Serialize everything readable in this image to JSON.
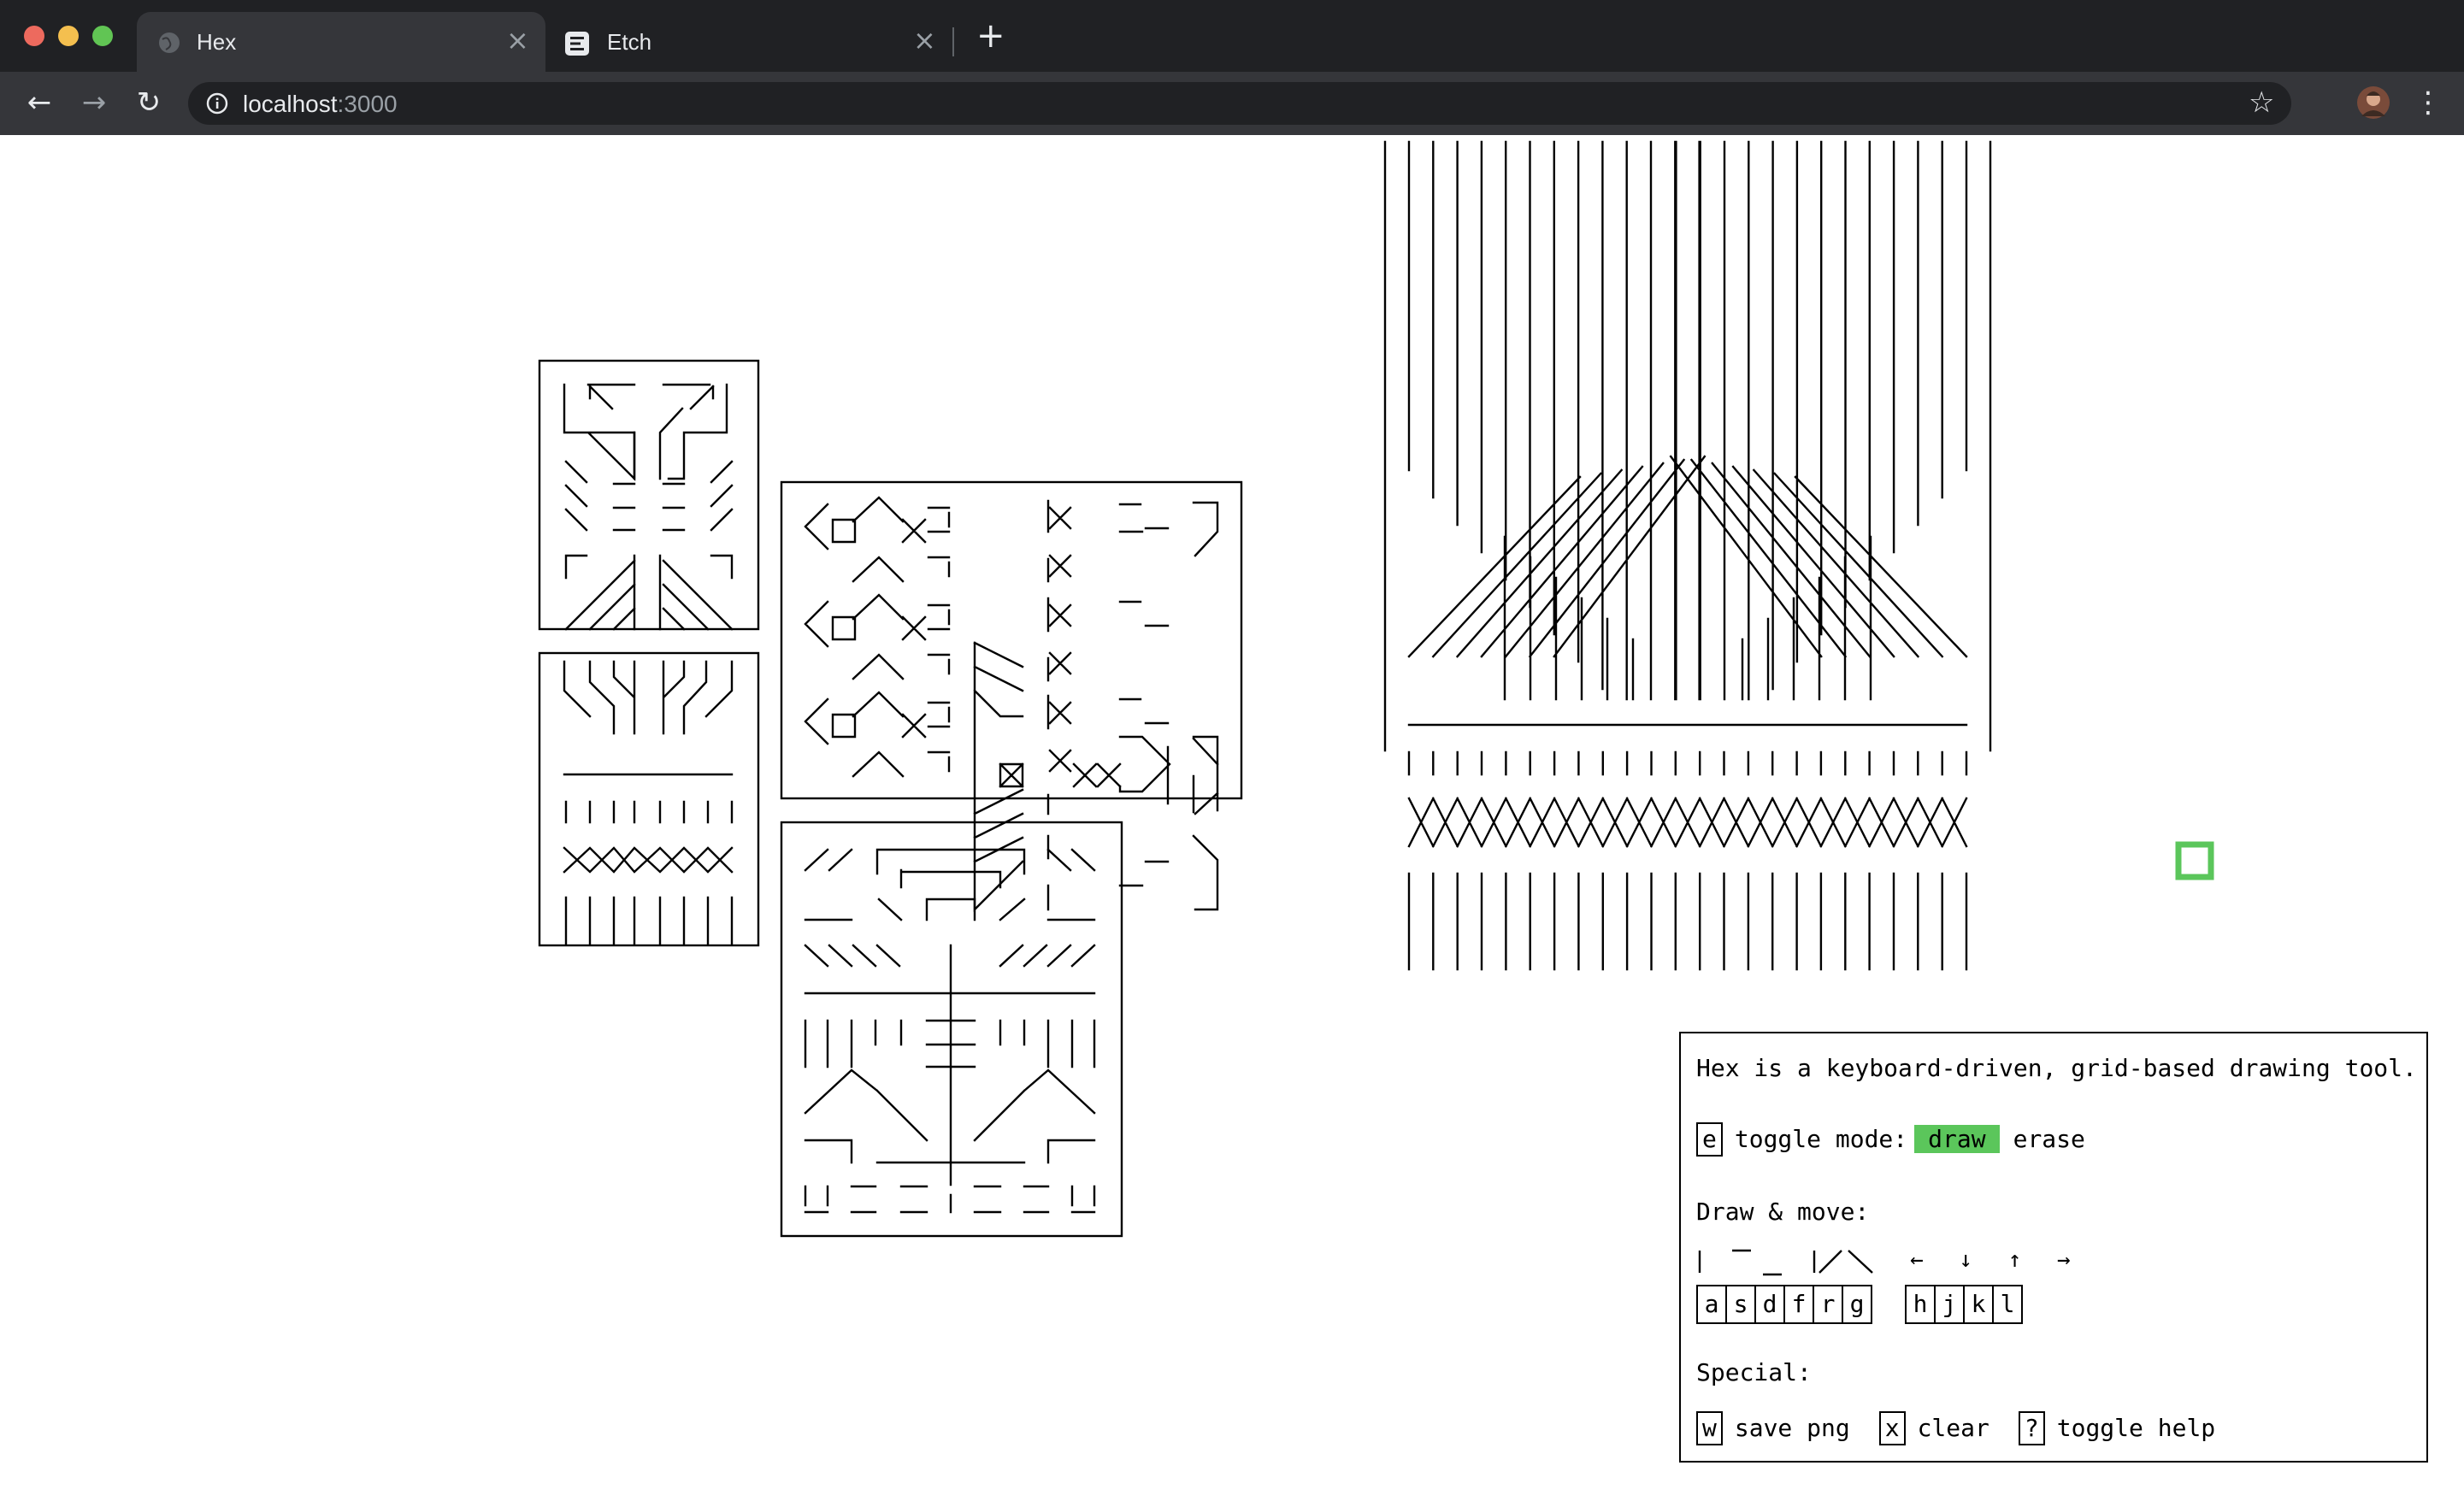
{
  "browser": {
    "tabs": [
      {
        "title": "Hex",
        "active": true
      },
      {
        "title": "Etch",
        "active": false
      }
    ],
    "new_tab": "+",
    "url_host": "localhost",
    "url_port": ":3000"
  },
  "help": {
    "intro": "Hex is a keyboard-driven, grid-based drawing tool.",
    "mode_key": "e",
    "mode_label": "toggle mode:",
    "mode_draw": "draw",
    "mode_erase": "erase",
    "draw_move_heading": "Draw & move:",
    "draw_keys": [
      "a",
      "s",
      "d",
      "f",
      "r",
      "g"
    ],
    "move_keys": [
      "h",
      "j",
      "k",
      "l"
    ],
    "move_arrows": "← ↓ ↑ →",
    "special_heading": "Special:",
    "special": [
      {
        "key": "w",
        "label": "save png"
      },
      {
        "key": "x",
        "label": "clear"
      },
      {
        "key": "?",
        "label": "toggle help"
      }
    ]
  },
  "colors": {
    "accent": "#5bc65b",
    "chrome_bg": "#202124",
    "toolbar_bg": "#35363a"
  }
}
